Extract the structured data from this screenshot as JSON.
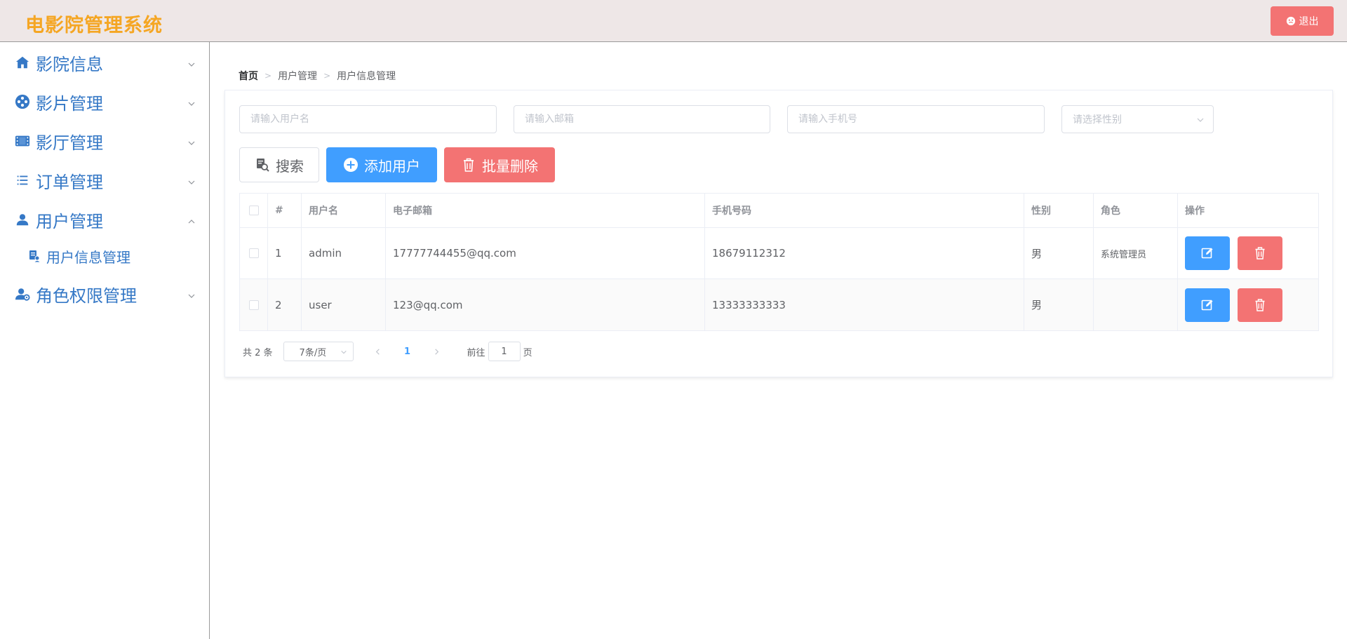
{
  "header": {
    "title": "电影院管理系统",
    "logout_label": "退出"
  },
  "sidebar": {
    "items": [
      {
        "label": "影院信息",
        "icon": "home-icon",
        "expanded": false
      },
      {
        "label": "影片管理",
        "icon": "film-reel-icon",
        "expanded": false
      },
      {
        "label": "影厅管理",
        "icon": "film-strip-icon",
        "expanded": false
      },
      {
        "label": "订单管理",
        "icon": "list-icon",
        "expanded": false
      },
      {
        "label": "用户管理",
        "icon": "user-icon",
        "expanded": true,
        "children": [
          {
            "label": "用户信息管理",
            "icon": "user-doc-icon"
          }
        ]
      },
      {
        "label": "角色权限管理",
        "icon": "user-settings-icon",
        "expanded": false
      }
    ]
  },
  "breadcrumb": [
    "首页",
    "用户管理",
    "用户信息管理"
  ],
  "filters": {
    "username_placeholder": "请输入用户名",
    "email_placeholder": "请输入邮箱",
    "phone_placeholder": "请输入手机号",
    "gender_placeholder": "请选择性别"
  },
  "actions": {
    "search_label": "搜索",
    "add_label": "添加用户",
    "batch_delete_label": "批量删除"
  },
  "table": {
    "columns": [
      "#",
      "用户名",
      "电子邮箱",
      "手机号码",
      "性别",
      "角色",
      "操作"
    ],
    "rows": [
      {
        "index": "1",
        "username": "admin",
        "email": "17777744455@qq.com",
        "phone": "18679112312",
        "gender": "男",
        "role": "系统管理员"
      },
      {
        "index": "2",
        "username": "user",
        "email": "123@qq.com",
        "phone": "13333333333",
        "gender": "男",
        "role": ""
      }
    ]
  },
  "pagination": {
    "total_text": "共 2 条",
    "page_size": "7条/页",
    "current_page": "1",
    "goto_prefix": "前往",
    "goto_value": "1",
    "goto_suffix": "页"
  },
  "colors": {
    "brand": "#f5a623",
    "primary": "#409eff",
    "danger": "#f37373",
    "menu_text": "#3578c6"
  }
}
